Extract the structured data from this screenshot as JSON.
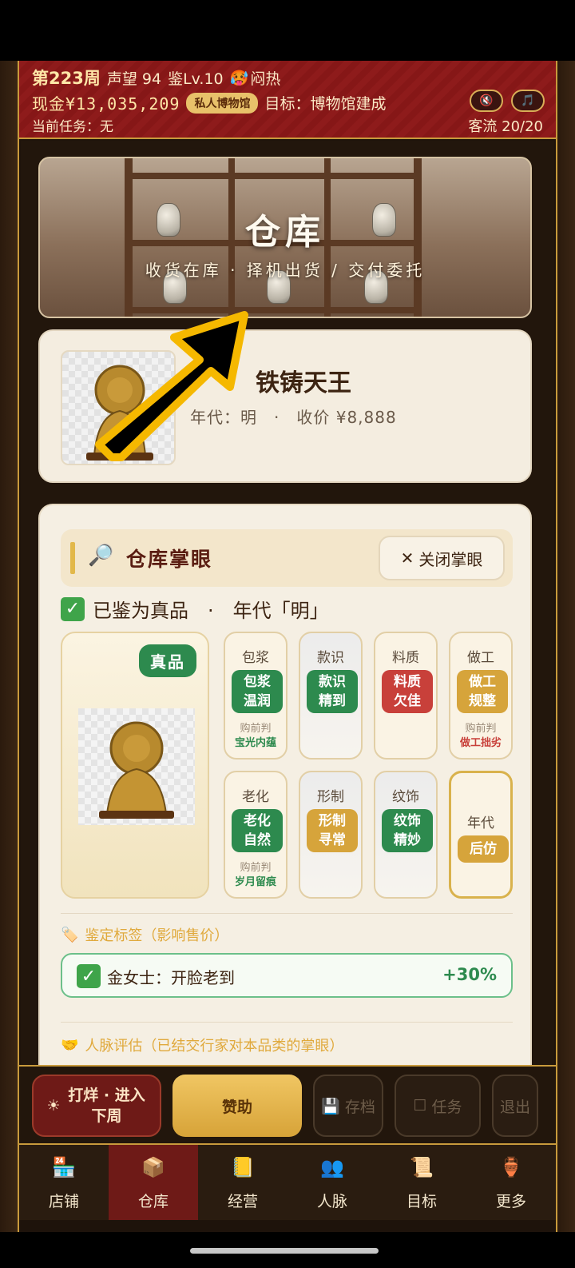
{
  "header": {
    "week": "第223周",
    "reputation": "声望 94",
    "level": "鉴Lv.10",
    "weather_icon": "🥵",
    "weather": "闷热",
    "cash": "现金¥13,035,209",
    "museum_badge": "私人博物馆",
    "goal": "目标：博物馆建成",
    "task": "当前任务：无",
    "customers": "客流 20/20",
    "sound_icon": "🔇",
    "music_icon": "🎵"
  },
  "banner": {
    "title": "仓库",
    "subtitle": "收货在库 · 择机出货 / 交付委托"
  },
  "item": {
    "name": "铁铸天王",
    "meta": "年代：明　·　收价 ¥8,888"
  },
  "appraisal": {
    "title": "仓库掌眼",
    "close_label": "关闭掌眼",
    "verdict": "已鉴为真品　·　年代「明」",
    "genuine_tag": "真品",
    "tiles": [
      {
        "name": "包浆",
        "result": "包浆温润",
        "color": "green",
        "pre_label": "购前判",
        "pre_result": "宝光内蕴",
        "pre_color": "green"
      },
      {
        "name": "款识",
        "result": "款识精到",
        "color": "green"
      },
      {
        "name": "料质",
        "result": "料质欠佳",
        "color": "red"
      },
      {
        "name": "做工",
        "result": "做工规整",
        "color": "gold",
        "pre_label": "购前判",
        "pre_result": "做工拙劣",
        "pre_color": "red"
      },
      {
        "name": "老化",
        "result": "老化自然",
        "color": "green",
        "pre_label": "购前判",
        "pre_result": "岁月留痕",
        "pre_color": "green"
      },
      {
        "name": "形制",
        "result": "形制寻常",
        "color": "gold"
      },
      {
        "name": "纹饰",
        "result": "纹饰精妙",
        "color": "green"
      },
      {
        "name": "年代",
        "result": "后仿",
        "color": "gold"
      }
    ],
    "label_section": "鉴定标签（影响售价）",
    "label_row": {
      "text": "金女士：开脸老到",
      "value": "+30%"
    },
    "network_section": "人脉评估（已结交行家对本品类的掌眼）"
  },
  "actions": {
    "next_week": "打烊 · 进入下周",
    "sponsor": "赞助",
    "save": "存档",
    "task": "任务",
    "exit": "退出"
  },
  "nav": [
    {
      "label": "店铺",
      "icon": "shop-icon",
      "active": false
    },
    {
      "label": "仓库",
      "icon": "warehouse-icon",
      "active": true
    },
    {
      "label": "经营",
      "icon": "business-icon",
      "active": false
    },
    {
      "label": "人脉",
      "icon": "contacts-icon",
      "active": false
    },
    {
      "label": "目标",
      "icon": "goal-icon",
      "active": false
    },
    {
      "label": "更多",
      "icon": "more-icon",
      "active": false
    }
  ],
  "colors": {
    "header_red": "#8e1b1b",
    "gold": "#c89a3c",
    "green": "#2d8a4e",
    "red": "#c8403a",
    "amber": "#d6a43b"
  }
}
